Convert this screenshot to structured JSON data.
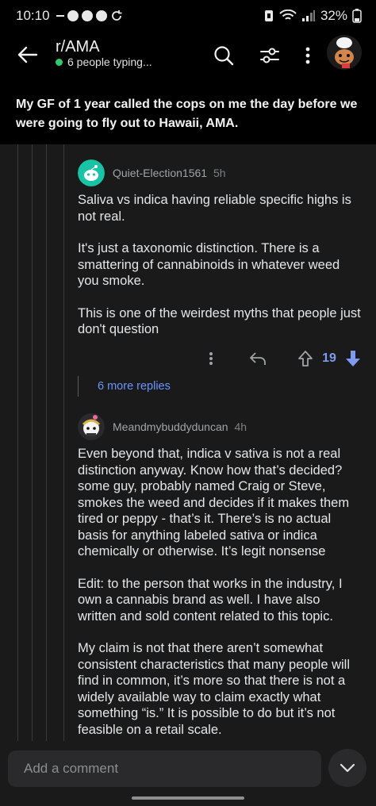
{
  "status_bar": {
    "time": "10:10",
    "battery": "32%"
  },
  "header": {
    "subreddit": "r/AMA",
    "typing": "6 people typing..."
  },
  "post": {
    "title": "My GF of 1 year called the cops on me the day before we were going to fly out to Hawaii, AMA."
  },
  "comments": [
    {
      "username": "Quiet-Election1561",
      "age": "5h",
      "avatar_color": "#18c4a6",
      "paragraphs": [
        "Saliva vs indica having reliable specific highs is not real.",
        "It's just a taxonomic distinction. There is a smattering of cannabinoids in whatever weed you smoke.",
        "This is one of the weirdest myths that people just don't question"
      ],
      "votes": "19"
    },
    {
      "username": "Meandmybuddyduncan",
      "age": "4h",
      "paragraphs": [
        "Even beyond that, indica v sativa is not a real distinction anyway. Know how that’s decided?  some guy, probably named Craig or Steve, smokes the weed and decides if it makes them tired or peppy - that’s it. There’s is no actual basis for anything labeled sativa or indica chemically or otherwise. It’s legit nonsense",
        "Edit: to the person that works in the industry, I own a cannabis brand as well. I have also written and sold content related to this topic.",
        "My claim is not that there aren’t somewhat consistent characteristics that many people will find in common, it’s more so that there is not a widely available way to claim exactly what something “is.” It is possible to do but it’s not feasible on a retail scale."
      ]
    }
  ],
  "more_replies": "6 more replies",
  "composer": {
    "placeholder": "Add a comment"
  },
  "colors": {
    "accent_blue": "#6a95ff",
    "online_green": "#2ecc71",
    "background": "#1a1a1b"
  }
}
